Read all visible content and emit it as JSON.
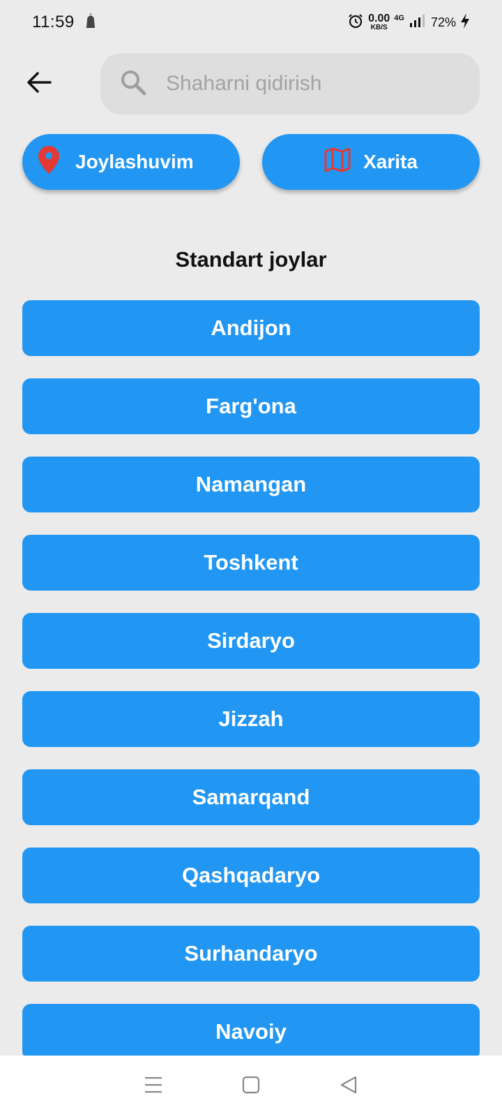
{
  "status_bar": {
    "time": "11:59",
    "speed_value": "0.00",
    "speed_unit": "KB/S",
    "network": "4G",
    "battery": "72%"
  },
  "search": {
    "placeholder": "Shaharni qidirish",
    "value": ""
  },
  "actions": {
    "location_label": "Joylashuvim",
    "map_label": "Xarita"
  },
  "section_title": "Standart joylar",
  "cities": [
    "Andijon",
    "Farg'ona",
    "Namangan",
    "Toshkent",
    "Sirdaryo",
    "Jizzah",
    "Samarqand",
    "Qashqadaryo",
    "Surhandaryo",
    "Navoiy"
  ],
  "colors": {
    "accent": "#2196f3",
    "icon_red": "#e53935",
    "background": "#ebebeb",
    "search_bg": "#dedede"
  },
  "icons": {
    "back": "arrow-left-icon",
    "search": "search-icon",
    "location": "location-pin-icon",
    "map": "map-icon"
  }
}
